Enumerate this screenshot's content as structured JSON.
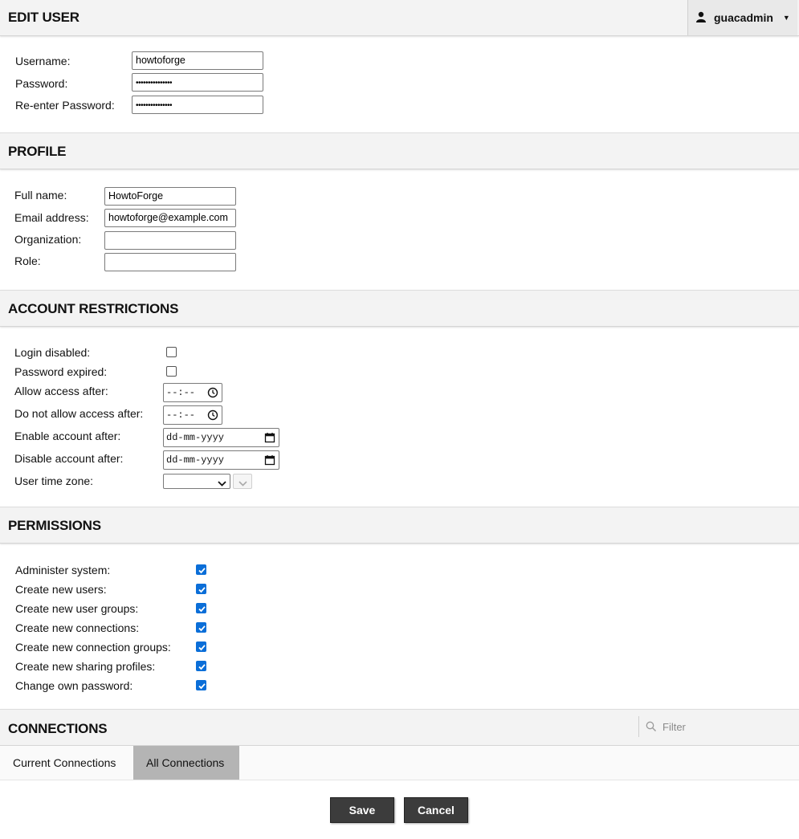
{
  "edit_user": {
    "title": "EDIT USER",
    "user_menu": {
      "icon": "person-icon",
      "username": "guacadmin"
    },
    "fields": [
      {
        "label": "Username:",
        "value": "howtoforge",
        "type": "text"
      },
      {
        "label": "Password:",
        "value": "•••••••••••••••",
        "type": "password"
      },
      {
        "label": "Re-enter Password:",
        "value": "•••••••••••••••",
        "type": "password"
      }
    ]
  },
  "profile": {
    "title": "PROFILE",
    "fields": [
      {
        "label": "Full name:",
        "value": "HowtoForge"
      },
      {
        "label": "Email address:",
        "value": "howtoforge@example.com"
      },
      {
        "label": "Organization:",
        "value": ""
      },
      {
        "label": "Role:",
        "value": ""
      }
    ]
  },
  "account_restrictions": {
    "title": "ACCOUNT RESTRICTIONS",
    "login_disabled": {
      "label": "Login disabled:",
      "checked": false
    },
    "password_expired": {
      "label": "Password expired:",
      "checked": false
    },
    "allow_access_after": {
      "label": "Allow access after:",
      "placeholder": "--:--"
    },
    "do_not_allow_access_after": {
      "label": "Do not allow access after:",
      "placeholder": "--:--"
    },
    "enable_account_after": {
      "label": "Enable account after:",
      "placeholder": "dd-mm-yyyy"
    },
    "disable_account_after": {
      "label": "Disable account after:",
      "placeholder": "dd-mm-yyyy"
    },
    "user_time_zone": {
      "label": "User time zone:",
      "value": ""
    }
  },
  "permissions": {
    "title": "PERMISSIONS",
    "items": [
      {
        "label": "Administer system:",
        "checked": true
      },
      {
        "label": "Create new users:",
        "checked": true
      },
      {
        "label": "Create new user groups:",
        "checked": true
      },
      {
        "label": "Create new connections:",
        "checked": true
      },
      {
        "label": "Create new connection groups:",
        "checked": true
      },
      {
        "label": "Create new sharing profiles:",
        "checked": true
      },
      {
        "label": "Change own password:",
        "checked": true
      }
    ]
  },
  "connections": {
    "title": "CONNECTIONS",
    "filter_placeholder": "Filter",
    "tabs": [
      {
        "label": "Current Connections",
        "active": false
      },
      {
        "label": "All Connections",
        "active": true
      }
    ]
  },
  "actions": {
    "save_label": "Save",
    "cancel_label": "Cancel"
  },
  "colors": {
    "checkbox_accent": "#0a6ed8",
    "button_bg": "#3c3c3c",
    "header_bg": "#f3f3f3",
    "active_tab_bg": "#b4b4b4"
  }
}
